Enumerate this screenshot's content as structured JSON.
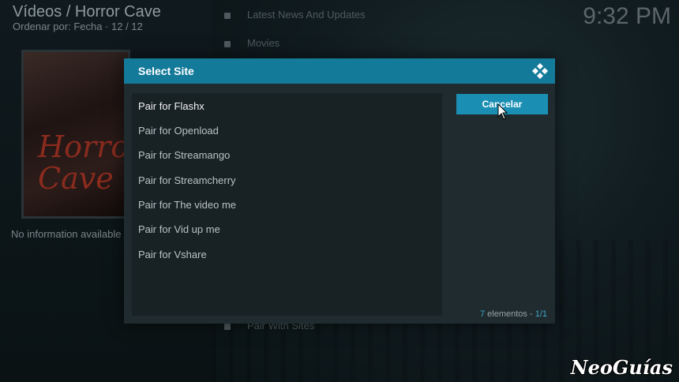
{
  "header": {
    "title": "Vídeos / Horror Cave",
    "subtitle": "Ordenar por: Fecha · 12 / 12"
  },
  "clock": "9:32 PM",
  "left_panel": {
    "poster_text": "Horror\nCave",
    "no_info": "No information available"
  },
  "background_menu": {
    "items": [
      {
        "label": "Latest News And Updates"
      },
      {
        "label": "Movies"
      },
      {
        "label": "Pair With Sites"
      }
    ]
  },
  "dialog": {
    "title": "Select Site",
    "items": [
      {
        "label": "Pair for Flashx"
      },
      {
        "label": "Pair for Openload"
      },
      {
        "label": "Pair for Streamango"
      },
      {
        "label": "Pair for Streamcherry"
      },
      {
        "label": "Pair for The video me"
      },
      {
        "label": "Pair for Vid up me"
      },
      {
        "label": "Pair for Vshare"
      }
    ],
    "cancel_label": "Cancelar",
    "count": {
      "items_count": "7",
      "items_word": "elementos",
      "separator": "-",
      "page": "1/1"
    }
  },
  "watermark": "NeoGuías",
  "colors": {
    "accent": "#147a9a",
    "button": "#1a8fb3",
    "dialog_bg": "#1f2b2f"
  },
  "icons": {
    "dialog_logo": "kodi-logo-icon",
    "cursor": "mouse-pointer-icon"
  }
}
